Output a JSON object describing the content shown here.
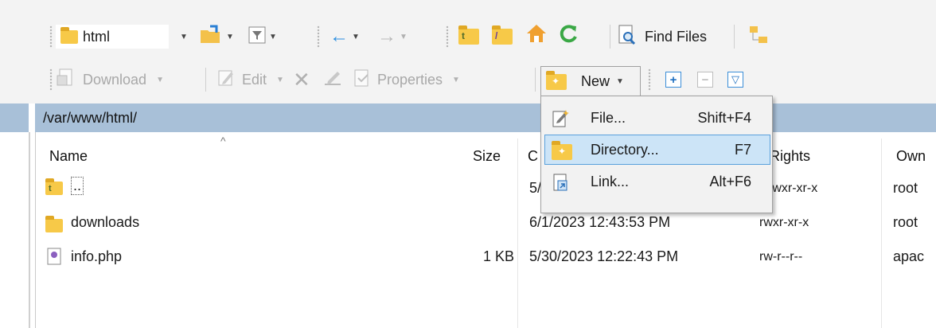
{
  "toolbar1": {
    "location_combo": "html",
    "find_files_label": "Find Files"
  },
  "toolbar2": {
    "download_label": "Download",
    "edit_label": "Edit",
    "properties_label": "Properties",
    "new_label": "New"
  },
  "path": "/var/www/html/",
  "columns": {
    "name": "Name",
    "size": "Size",
    "changed": "C",
    "rights": "Rights",
    "owner": "Own"
  },
  "files": [
    {
      "name": "..",
      "size": "",
      "changed": "5/",
      "rights": "rwxr-xr-x",
      "owner": "root",
      "icon": "parent-folder-icon"
    },
    {
      "name": "downloads",
      "size": "",
      "changed": "6/1/2023 12:43:53 PM",
      "rights": "rwxr-xr-x",
      "owner": "root",
      "icon": "folder-icon"
    },
    {
      "name": "info.php",
      "size": "1 KB",
      "changed": "5/30/2023 12:22:43 PM",
      "rights": "rw-r--r--",
      "owner": "apac",
      "icon": "php-file-icon"
    }
  ],
  "new_menu": {
    "items": [
      {
        "label": "File...",
        "shortcut": "Shift+F4",
        "icon": "new-file-icon"
      },
      {
        "label": "Directory...",
        "shortcut": "F7",
        "icon": "new-directory-icon",
        "highlighted": true
      },
      {
        "label": "Link...",
        "shortcut": "Alt+F6",
        "icon": "new-link-icon"
      }
    ]
  },
  "colors": {
    "path_bar": "#a8c0d8",
    "menu_highlight": "#cce4f7",
    "menu_highlight_border": "#5aa0dc"
  }
}
